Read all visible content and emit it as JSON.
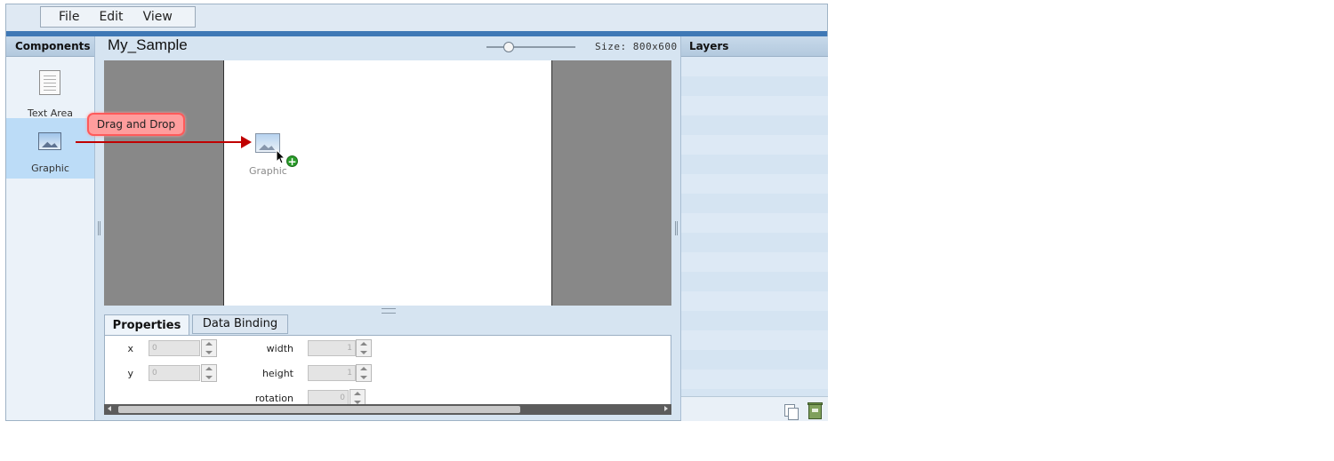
{
  "menu": {
    "items": [
      "File",
      "Edit",
      "View"
    ]
  },
  "components": {
    "header": "Components",
    "items": [
      {
        "label": "Text Area",
        "icon": "text-area-icon"
      },
      {
        "label": "Graphic",
        "icon": "graphic-icon",
        "selected": true
      }
    ]
  },
  "document": {
    "title": "My_Sample",
    "size_label": "Size: 800x600",
    "zoom_fraction": 0.25
  },
  "drag": {
    "callout": "Drag and Drop",
    "ghost_label": "Graphic",
    "arrow_color": "#c00000"
  },
  "properties": {
    "tabs": [
      "Properties",
      "Data Binding"
    ],
    "active_tab": "Properties",
    "fields": {
      "x_label": "x",
      "x_value": "0",
      "y_label": "y",
      "y_value": "0",
      "width_label": "width",
      "width_value": "1",
      "height_label": "height",
      "height_value": "1",
      "rotation_label": "rotation",
      "rotation_value": "0"
    }
  },
  "layers": {
    "header": "Layers"
  },
  "colors": {
    "accent": "#3f78b5",
    "selected_item": "#bcdcf7",
    "stage": "#888888"
  }
}
